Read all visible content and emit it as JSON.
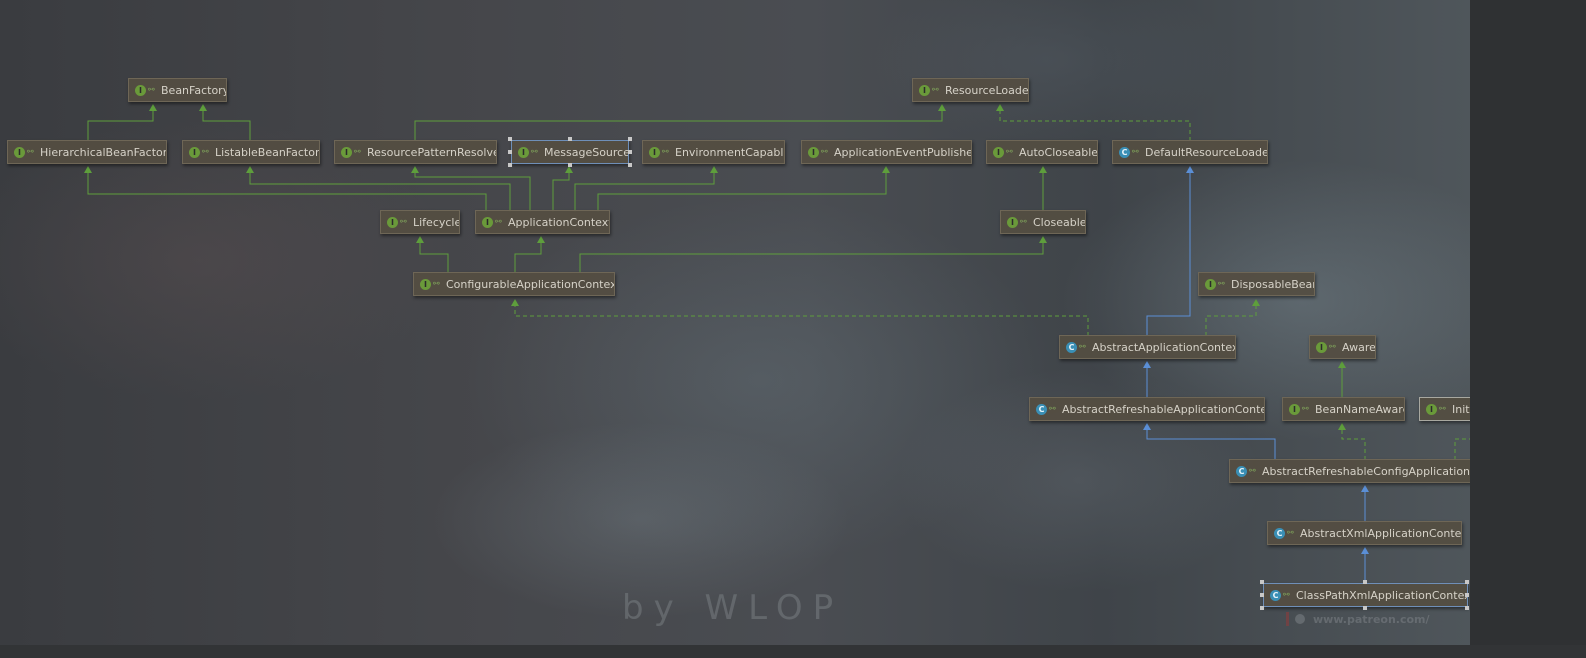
{
  "diagram": {
    "nodes": {
      "bean_factory": {
        "label": "BeanFactory",
        "kind": "interface"
      },
      "resource_loader": {
        "label": "ResourceLoader",
        "kind": "interface"
      },
      "hierarchical_bean_factory": {
        "label": "HierarchicalBeanFactory",
        "kind": "interface"
      },
      "listable_bean_factory": {
        "label": "ListableBeanFactory",
        "kind": "interface"
      },
      "resource_pattern_resolver": {
        "label": "ResourcePatternResolver",
        "kind": "interface"
      },
      "message_source": {
        "label": "MessageSource",
        "kind": "interface"
      },
      "environment_capable": {
        "label": "EnvironmentCapable",
        "kind": "interface"
      },
      "application_event_publisher": {
        "label": "ApplicationEventPublisher",
        "kind": "interface"
      },
      "auto_closeable": {
        "label": "AutoCloseable",
        "kind": "interface"
      },
      "default_resource_loader": {
        "label": "DefaultResourceLoader",
        "kind": "class"
      },
      "lifecycle": {
        "label": "Lifecycle",
        "kind": "interface"
      },
      "application_context": {
        "label": "ApplicationContext",
        "kind": "interface"
      },
      "closeable": {
        "label": "Closeable",
        "kind": "interface"
      },
      "configurable_application_context": {
        "label": "ConfigurableApplicationContext",
        "kind": "interface"
      },
      "disposable_bean": {
        "label": "DisposableBean",
        "kind": "interface"
      },
      "abstract_application_context": {
        "label": "AbstractApplicationContext",
        "kind": "class"
      },
      "aware": {
        "label": "Aware",
        "kind": "interface"
      },
      "abstract_refreshable_application_context": {
        "label": "AbstractRefreshableApplicationContext",
        "kind": "class"
      },
      "bean_name_aware": {
        "label": "BeanNameAware",
        "kind": "interface"
      },
      "initializing_bean": {
        "label": "InitializingBean",
        "kind": "interface"
      },
      "abstract_refreshable_config_application_context": {
        "label": "AbstractRefreshableConfigApplicationContext",
        "kind": "class"
      },
      "abstract_xml_application_context": {
        "label": "AbstractXmlApplicationContext",
        "kind": "class"
      },
      "class_path_xml_application_context": {
        "label": "ClassPathXmlApplicationContext",
        "kind": "class"
      }
    },
    "edge_colors": {
      "interface_extends": "#5e9e3c",
      "class_extends": "#5b8fd6",
      "implements": "#5e9e3c"
    }
  },
  "background": {
    "watermark": "by WLOP",
    "patreon": "www.patreon.com/"
  }
}
